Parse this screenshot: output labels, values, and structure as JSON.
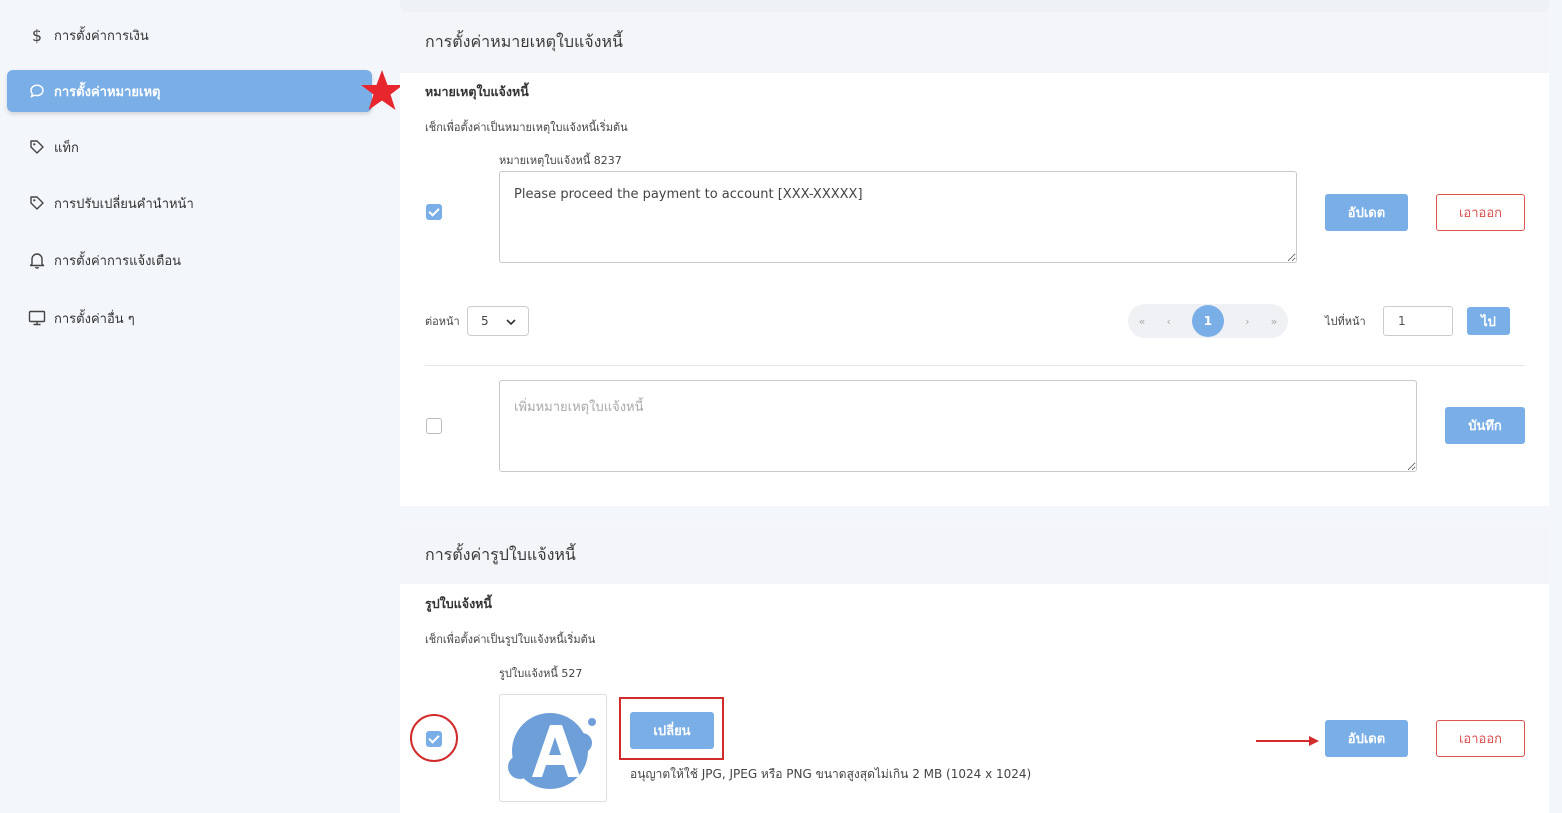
{
  "sidebar": {
    "items": [
      {
        "label": "การตั้งค่าการเงิน",
        "icon": "dollar-icon"
      },
      {
        "label": "การตั้งค่าหมายเหตุ",
        "icon": "chat-bubble-icon",
        "active": true
      },
      {
        "label": "แท็ก",
        "icon": "tag-icon"
      },
      {
        "label": "การปรับเปลี่ยนคำนำหน้า",
        "icon": "tag-icon"
      },
      {
        "label": "การตั้งค่าการแจ้งเตือน",
        "icon": "bell-icon"
      },
      {
        "label": "การตั้งค่าอื่น ๆ",
        "icon": "monitor-icon"
      }
    ]
  },
  "notes_section": {
    "title": "การตั้งค่าหมายเหตุใบแจ้งหนี้",
    "subtitle": "หมายเหตุใบแจ้งหนี้",
    "hint": "เช็กเพื่อตั้งค่าเป็นหมายเหตุใบแจ้งหนี้เริ่มต้น",
    "note_label": "หมายเหตุใบแจ้งหนี้ 8237",
    "note_value": "Please proceed the payment to account [XXX-XXXXX]",
    "update_label": "อัปเดต",
    "remove_label": "เอาออก",
    "per_page_label": "ต่อหน้า",
    "per_page_value": "5",
    "pager": {
      "first": "«",
      "prev": "‹",
      "current": "1",
      "next": "›",
      "last": "»"
    },
    "goto_label": "ไปที่หน้า",
    "goto_value": "1",
    "go_label": "ไป",
    "new_note_placeholder": "เพิ่มหมายเหตุใบแจ้งหนี้",
    "save_label": "บันทึก"
  },
  "image_section": {
    "title": "การตั้งค่ารูปใบแจ้งหนี้",
    "subtitle": "รูปใบแจ้งหนี้",
    "hint": "เช็กเพื่อตั้งค่าเป็นรูปใบแจ้งหนี้เริ่มต้น",
    "image_label": "รูปใบแจ้งหนี้ 527",
    "change_label": "เปลี่ยน",
    "file_hint": "อนุญาตให้ใช้ JPG, JPEG หรือ PNG ขนาดสูงสุดไม่เกิน 2 MB (1024 x 1024)",
    "update_label": "อัปเดต",
    "remove_label": "เอาออก"
  },
  "colors": {
    "accent": "#7aaee6",
    "danger": "#d9534f",
    "annotation_red": "#d12b2b"
  }
}
